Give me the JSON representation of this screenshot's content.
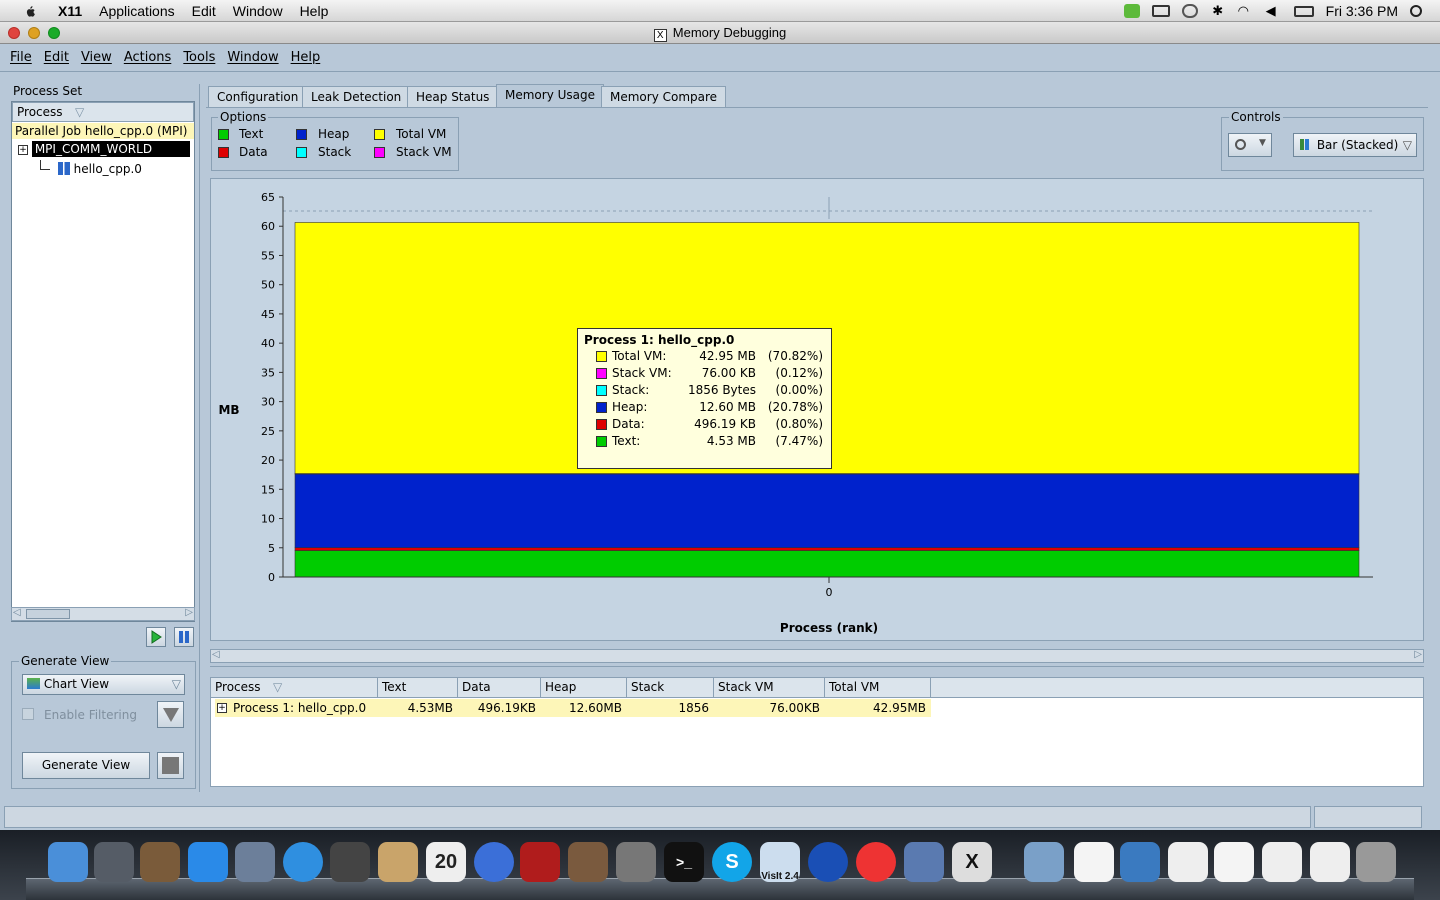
{
  "macmenu": {
    "items": [
      "X11",
      "Applications",
      "Edit",
      "Window",
      "Help"
    ],
    "clock": "Fri 3:36 PM"
  },
  "window": {
    "title": "Memory Debugging"
  },
  "appmenu": {
    "items": [
      "File",
      "Edit",
      "View",
      "Actions",
      "Tools",
      "Window",
      "Help"
    ]
  },
  "process_set": {
    "label": "Process Set",
    "column": "Process",
    "tree": [
      "Parallel Job hello_cpp.0 (MPI)",
      "MPI_COMM_WORLD",
      "hello_cpp.0"
    ]
  },
  "generate_view": {
    "label": "Generate View",
    "view_select": "Chart View",
    "filter_label": "Enable Filtering",
    "button": "Generate View"
  },
  "tabs": [
    "Configuration",
    "Leak Detection",
    "Heap Status",
    "Memory Usage",
    "Memory Compare"
  ],
  "active_tab": "Memory Usage",
  "options": {
    "label": "Options",
    "items": [
      {
        "label": "Text",
        "color": "#00cc00"
      },
      {
        "label": "Data",
        "color": "#dd0000"
      },
      {
        "label": "Heap",
        "color": "#0022cc"
      },
      {
        "label": "Stack",
        "color": "#00ffff"
      },
      {
        "label": "Total VM",
        "color": "#ffff00"
      },
      {
        "label": "Stack VM",
        "color": "#ff00ff"
      }
    ]
  },
  "controls": {
    "label": "Controls",
    "chart_type": "Bar (Stacked)"
  },
  "chart_data": {
    "type": "bar",
    "stacked": true,
    "categories": [
      "0"
    ],
    "xlabel": "Process (rank)",
    "ylabel": "MB",
    "ylim": [
      0,
      65
    ],
    "yticks": [
      0,
      5,
      10,
      15,
      20,
      25,
      30,
      35,
      40,
      45,
      50,
      55,
      60,
      65
    ],
    "series": [
      {
        "name": "Text",
        "values": [
          4.53
        ],
        "color": "#00cc00"
      },
      {
        "name": "Data",
        "values": [
          0.49
        ],
        "color": "#dd0000"
      },
      {
        "name": "Heap",
        "values": [
          12.6
        ],
        "color": "#0022cc"
      },
      {
        "name": "Stack",
        "values": [
          0.0018
        ],
        "color": "#00ffff"
      },
      {
        "name": "Stack VM",
        "values": [
          0.074
        ],
        "color": "#ff00ff"
      },
      {
        "name": "Total VM",
        "values": [
          42.95
        ],
        "color": "#ffff00"
      }
    ]
  },
  "tooltip": {
    "title": "Process 1: hello_cpp.0",
    "rows": [
      {
        "name": "Total VM:",
        "value": "42.95 MB",
        "pct": "(70.82%)",
        "color": "#ffff00"
      },
      {
        "name": "Stack VM:",
        "value": "76.00 KB",
        "pct": "(0.12%)",
        "color": "#ff00ff"
      },
      {
        "name": "Stack:",
        "value": "1856 Bytes",
        "pct": "(0.00%)",
        "color": "#00ffff"
      },
      {
        "name": "Heap:",
        "value": "12.60 MB",
        "pct": "(20.78%)",
        "color": "#0022cc"
      },
      {
        "name": "Data:",
        "value": "496.19 KB",
        "pct": "(0.80%)",
        "color": "#dd0000"
      },
      {
        "name": "Text:",
        "value": "4.53 MB",
        "pct": "(7.47%)",
        "color": "#00cc00"
      }
    ]
  },
  "table": {
    "columns": [
      "Process",
      "Text",
      "Data",
      "Heap",
      "Stack",
      "Stack VM",
      "Total VM"
    ],
    "rows": [
      [
        "Process 1: hello_cpp.0",
        "4.53MB",
        "496.19KB",
        "12.60MB",
        "1856",
        "76.00KB",
        "42.95MB"
      ]
    ]
  },
  "dock": {
    "items": [
      "finder-icon",
      "launchpad-icon",
      "preview-icon",
      "app-store-icon",
      "mail-icon",
      "safari-icon",
      "facetime-icon",
      "address-book-icon",
      "calendar-icon",
      "itunes-icon",
      "photo-booth-icon",
      "iphoto-icon",
      "system-preferences-icon",
      "terminal-icon",
      "skype-icon",
      "visit-icon",
      "quicktime-icon",
      "chrome-icon",
      "preview-viewer-icon",
      "x11-icon",
      "folder-icon",
      "document-icon",
      "document-icon-2",
      "document-icon-3",
      "document-icon-4",
      "window-icon",
      "window-icon-2",
      "trash-icon"
    ],
    "calendar_day": "20",
    "visit_label": "VisIt 2.4"
  }
}
